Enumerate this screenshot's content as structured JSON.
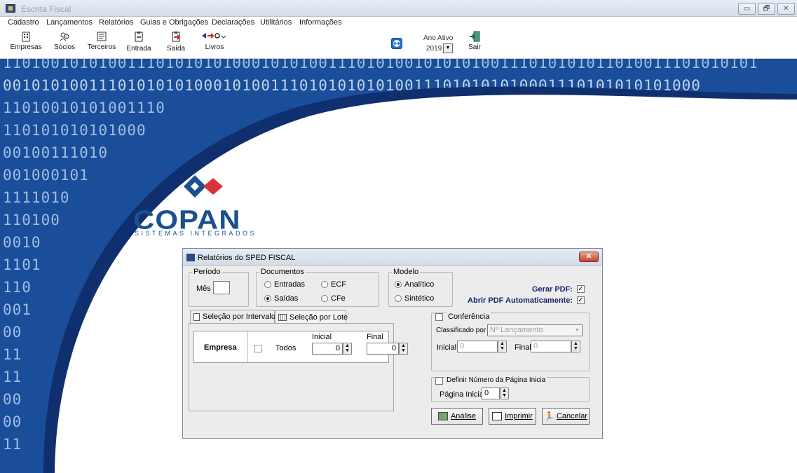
{
  "app": {
    "title": "Escrita Fiscal"
  },
  "window_controls": {
    "minimize": "▭",
    "restore": "🗗",
    "close": "✕"
  },
  "menu": [
    "Cadastro",
    "Lançamentos",
    "Relatórios",
    "Guias e Obrigações",
    "Declarações",
    "Utilitários",
    "Informações"
  ],
  "toolbar": {
    "buttons": [
      {
        "label": "Empresas",
        "icon": "building-icon"
      },
      {
        "label": "Sócios",
        "icon": "partners-icon"
      },
      {
        "label": "Terceiros",
        "icon": "contacts-icon"
      },
      {
        "label": "Entrada",
        "icon": "clipboard-in-icon"
      },
      {
        "label": "Saída",
        "icon": "clipboard-out-icon"
      },
      {
        "label": "Livros",
        "icon": "books-icon"
      }
    ],
    "ano_ativo_label": "Ano Ativo",
    "ano_ativo_value": "2019",
    "sair_label": "Sair"
  },
  "background": {
    "binary_rows": [
      "1101001010100111010101010001010100111010100101010100111010101011010011101010101",
      "0010101001110101010100010100111010101010100111010101010001110101010101000",
      "11010010101001110",
      "110101010101000",
      "00100111010",
      "001000101",
      "1111010",
      "110100",
      "0010",
      "1101",
      "110",
      "001",
      "00",
      "11",
      "11",
      "00",
      "00",
      "11"
    ]
  },
  "logo": {
    "name": "COPAN",
    "subtitle": "SISTEMAS INTEGRADOS",
    "colors": {
      "blue": "#1c4f8e",
      "red": "#d9343a"
    }
  },
  "dialog": {
    "title": "Relatórios do SPED FISCAL",
    "periodo": {
      "legend": "Período",
      "mes_label": "Mês",
      "mes_value": ""
    },
    "documentos": {
      "legend": "Documentos",
      "options": [
        {
          "label": "Entradas",
          "checked": false
        },
        {
          "label": "ECF",
          "checked": false
        },
        {
          "label": "Saídas",
          "checked": true
        },
        {
          "label": "CFe",
          "checked": false
        }
      ]
    },
    "modelo": {
      "legend": "Modelo",
      "options": [
        {
          "label": "Analítico",
          "checked": true
        },
        {
          "label": "Sintético",
          "checked": false
        }
      ]
    },
    "gerar_pdf": {
      "label": "Gerar PDF:",
      "checked": true
    },
    "abrir_pdf": {
      "label": "Abrir PDF Automaticamente:",
      "checked": true
    },
    "tabs": [
      {
        "label": "Seleção por Intervalo",
        "active": true
      },
      {
        "label": "Seleção por Lote",
        "active": false
      }
    ],
    "grid": {
      "row_label": "Empresa",
      "todos_label": "Todos",
      "todos_checked": false,
      "inicial_label": "Inicial",
      "inicial_value": "0",
      "final_label": "Final",
      "final_value": "0"
    },
    "conferencia": {
      "label": "Conferência",
      "checked": false,
      "classificado_label": "Classificado por",
      "classificado_value": "Nº Lançamento",
      "inicial_label": "Inicial",
      "inicial_value": "0",
      "final_label": "Final",
      "final_value": "0"
    },
    "pagina": {
      "label": "Definir Número da  Página Inicia",
      "checked": false,
      "inicial_label": "Página Inicial",
      "inicial_value": "0"
    },
    "buttons": {
      "analise": "Análise",
      "imprimir": "Imprimir",
      "cancelar": "Cancelar"
    }
  }
}
